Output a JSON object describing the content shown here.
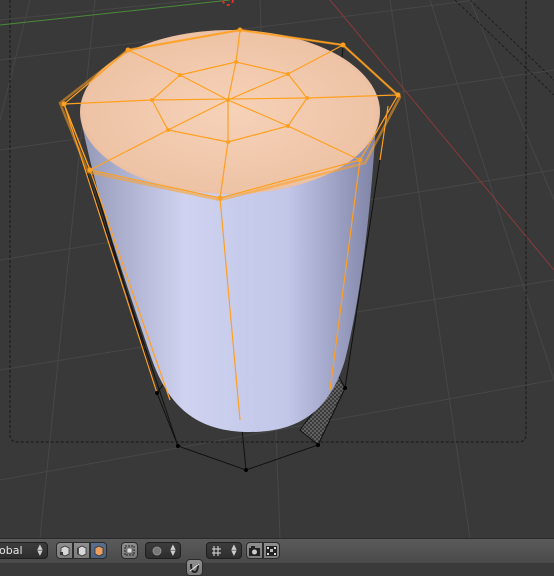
{
  "viewport": {
    "background": "#393939",
    "selected_top_face_color": "#f0c8a8",
    "edge_select_color": "#ffa020",
    "mesh_body_color": "#bfc4e6",
    "wire_color": "#111111",
    "grid_color": "#474747"
  },
  "header": {
    "orientation_select": {
      "value": "obal"
    },
    "select_modes": [
      {
        "icon": "vertex-select-icon",
        "active": false
      },
      {
        "icon": "edge-select-icon",
        "active": false
      },
      {
        "icon": "face-select-icon",
        "active": true
      }
    ],
    "occlude_toggle": {
      "icon": "limit-selection-visible-icon"
    },
    "proportional_edit": {
      "icon": "proportional-editing-icon"
    },
    "snap_toggle": {
      "icon": "snap-magnet-icon"
    },
    "snap_element": {
      "icon": "snap-increment-icon"
    },
    "render_buttons": [
      {
        "icon": "opengl-render-still-icon"
      },
      {
        "icon": "opengl-render-animation-icon"
      }
    ]
  }
}
